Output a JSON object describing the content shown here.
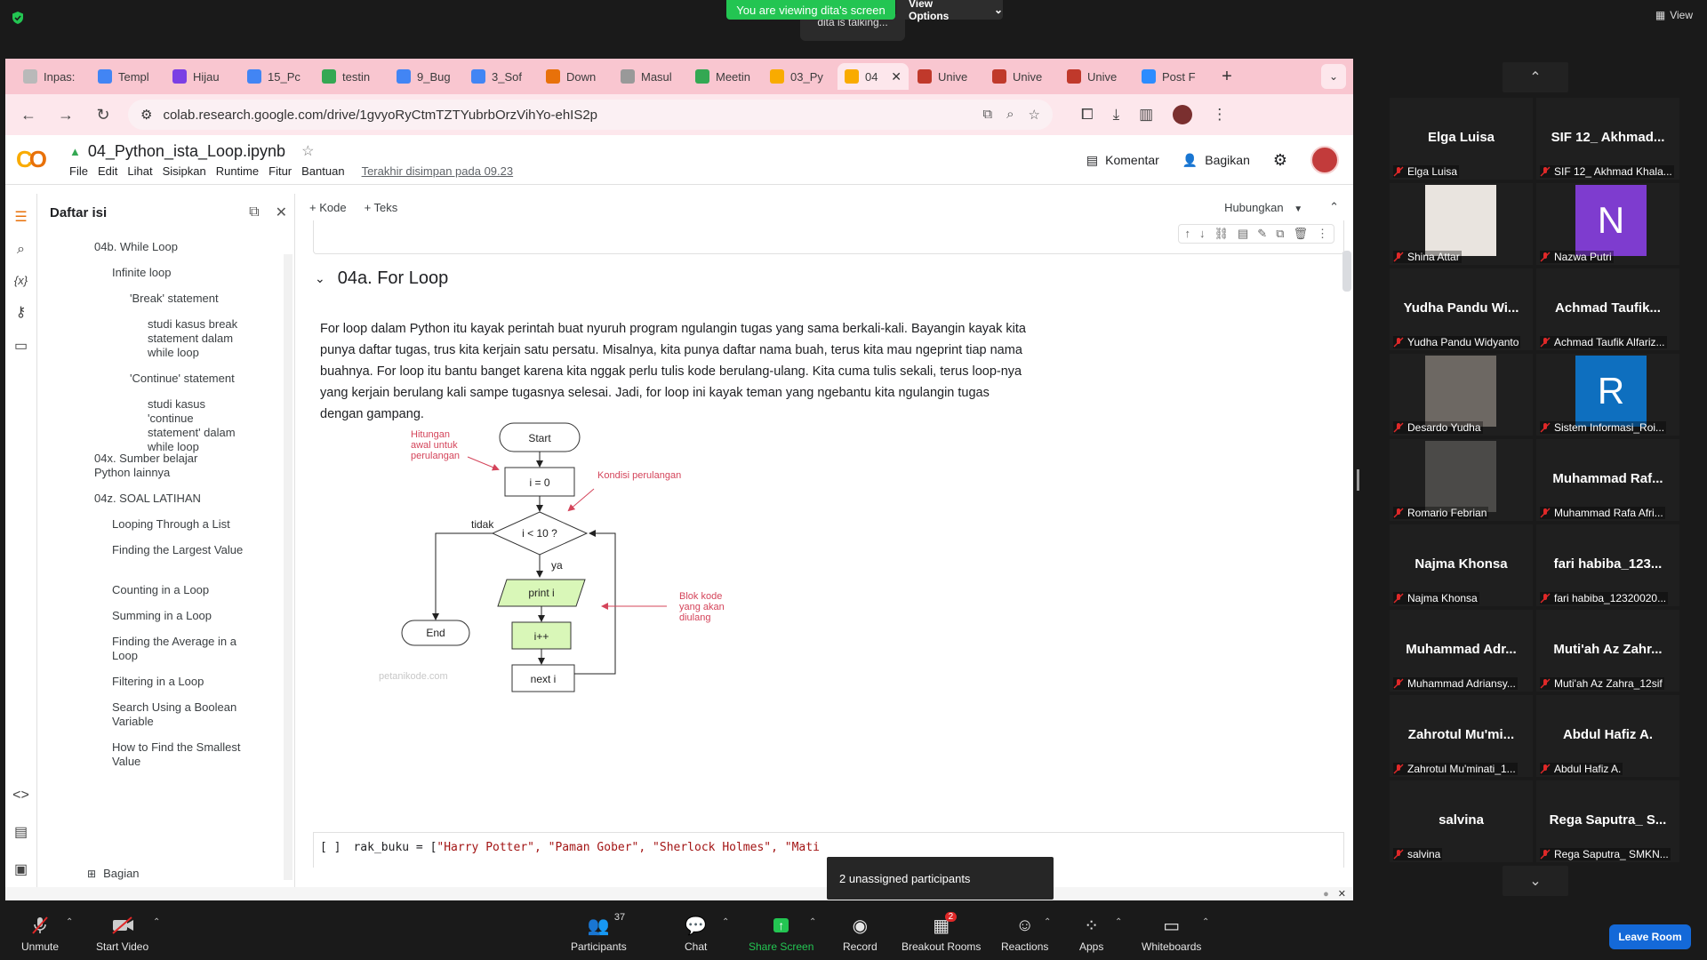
{
  "zoom": {
    "viewing_banner": "You are viewing dita's screen",
    "view_options": "View Options",
    "talking": "dita is talking...",
    "view_label": "View",
    "unassigned": "2 unassigned participants",
    "leave": "Leave Room",
    "controls": [
      {
        "label": "Unmute"
      },
      {
        "label": "Start Video"
      },
      {
        "label": "Participants",
        "count": "37"
      },
      {
        "label": "Chat"
      },
      {
        "label": "Share Screen"
      },
      {
        "label": "Record"
      },
      {
        "label": "Breakout Rooms",
        "badge": "2"
      },
      {
        "label": "Reactions"
      },
      {
        "label": "Apps"
      },
      {
        "label": "Whiteboards"
      }
    ]
  },
  "browser": {
    "tabs": [
      {
        "label": "Inpas:",
        "color": "#b9b9b9"
      },
      {
        "label": "Templ",
        "color": "#4285f4"
      },
      {
        "label": "Hijau",
        "color": "#7b3fe4"
      },
      {
        "label": "15_Pc",
        "color": "#4285f4"
      },
      {
        "label": "testin",
        "color": "#34a853"
      },
      {
        "label": "9_Bug",
        "color": "#4285f4"
      },
      {
        "label": "3_Sof",
        "color": "#4285f4"
      },
      {
        "label": "Down",
        "color": "#e8710a"
      },
      {
        "label": "Masul",
        "color": "#999999"
      },
      {
        "label": "Meetin",
        "color": "#34a853"
      },
      {
        "label": "03_Py",
        "color": "#f9ab00"
      },
      {
        "label": "04",
        "color": "#f9ab00"
      },
      {
        "label": "Unive",
        "color": "#c0392b"
      },
      {
        "label": "Unive",
        "color": "#c0392b"
      },
      {
        "label": "Unive",
        "color": "#c0392b"
      },
      {
        "label": "Post F",
        "color": "#2d8cff"
      }
    ],
    "url": "colab.research.google.com/drive/1gvyoRyCtmTZTYubrbOrzVihYo-ehIS2p"
  },
  "colab": {
    "title": "04_Python_ista_Loop.ipynb",
    "menu": [
      "File",
      "Edit",
      "Lihat",
      "Sisipkan",
      "Runtime",
      "Fitur",
      "Bantuan"
    ],
    "saved": "Terakhir disimpan pada 09.23",
    "comment": "Komentar",
    "share": "Bagikan",
    "add_code": "+ Kode",
    "add_text": "+ Teks",
    "connect": "Hubungkan",
    "toc_title": "Daftar isi",
    "toc": [
      {
        "label": "04b. While Loop",
        "level": 1
      },
      {
        "label": "Infinite loop",
        "level": 2
      },
      {
        "label": "'Break' statement",
        "level": 3
      },
      {
        "label": "studi kasus break statement dalam while loop",
        "level": 4
      },
      {
        "label": "'Continue' statement",
        "level": 3
      },
      {
        "label": "studi kasus 'continue statement' dalam while loop",
        "level": 4
      },
      {
        "label": "04x. Sumber belajar Python lainnya",
        "level": 1
      },
      {
        "label": "04z. SOAL LATIHAN",
        "level": 1
      },
      {
        "label": "Looping Through a List",
        "level": 2
      },
      {
        "label": "Finding the Largest Value",
        "level": 2
      },
      {
        "label": "Counting in a Loop",
        "level": 2
      },
      {
        "label": "Summing in a Loop",
        "level": 2
      },
      {
        "label": "Finding the Average in a Loop",
        "level": 2
      },
      {
        "label": "Filtering in a Loop",
        "level": 2
      },
      {
        "label": "Search Using a Boolean Variable",
        "level": 2
      },
      {
        "label": "How to Find the Smallest Value",
        "level": 2
      }
    ],
    "toc_section_btn": "Bagian",
    "section_heading": "04a. For Loop",
    "paragraph": "For loop dalam Python itu kayak perintah buat nyuruh program ngulangin tugas yang sama berkali-kali. Bayangin kayak kita punya daftar tugas, trus kita kerjain satu persatu. Misalnya, kita punya daftar nama buah, terus kita mau ngeprint tiap nama buahnya. For loop itu bantu banget karena kita nggak perlu tulis kode berulang-ulang. Kita cuma tulis sekali, terus loop-nya yang kerjain berulang kali sampe tugasnya selesai. Jadi, for loop ini kayak teman yang ngebantu kita ngulangin tugas dengan gampang.",
    "flowchart": {
      "start": "Start",
      "init": "i = 0",
      "cond": "i < 10 ?",
      "body": "print i",
      "inc": "i++",
      "next": "next i",
      "end": "End",
      "yes": "ya",
      "no": "tidak",
      "note_init": [
        "Hitungan",
        "awal untuk",
        "perulangan"
      ],
      "note_cond": "Kondisi perulangan",
      "note_body": [
        "Blok kode",
        "yang akan",
        "diulang"
      ],
      "watermark": "petanikode.com"
    },
    "code_bracket": "[ ]",
    "code_prefix": "rak_buku = [",
    "code_strings": [
      "\"Harry Potter\",",
      "\"Paman Gober\",",
      "\"Sherlock Holmes\",",
      "\"Mati"
    ]
  },
  "participants": [
    {
      "display": "Elga Luisa",
      "name": "Elga Luisa",
      "type": "name"
    },
    {
      "display": "SIF 12_ Akhmad...",
      "name": "SIF 12_ Akhmad Khala...",
      "type": "name"
    },
    {
      "display": "",
      "name": "Shina Attar",
      "type": "video",
      "color": "#e9e4df"
    },
    {
      "display": "N",
      "name": "Nazwa Putri",
      "type": "letter",
      "color": "#7e3ccf"
    },
    {
      "display": "Yudha Pandu Wi...",
      "name": "Yudha Pandu Widyanto",
      "type": "name"
    },
    {
      "display": "Achmad Taufik...",
      "name": "Achmad Taufik Alfariz...",
      "type": "name"
    },
    {
      "display": "",
      "name": "Desardo Yudha",
      "type": "video",
      "color": "#6d6863"
    },
    {
      "display": "R",
      "name": "Sistem Informasi_Roi...",
      "type": "letter",
      "color": "#0e6fbf"
    },
    {
      "display": "",
      "name": "Romario Febrian",
      "type": "video",
      "color": "#4b4a48"
    },
    {
      "display": "Muhammad Raf...",
      "name": "Muhammad Rafa Afri...",
      "type": "name"
    },
    {
      "display": "Najma Khonsa",
      "name": "Najma Khonsa",
      "type": "name"
    },
    {
      "display": "fari habiba_123...",
      "name": "fari habiba_12320020...",
      "type": "name"
    },
    {
      "display": "Muhammad Adr...",
      "name": "Muhammad Adriansy...",
      "type": "name"
    },
    {
      "display": "Muti'ah Az Zahr...",
      "name": "Muti'ah Az Zahra_12sif",
      "type": "name"
    },
    {
      "display": "Zahrotul Mu'mi...",
      "name": "Zahrotul Mu'minati_1...",
      "type": "name"
    },
    {
      "display": "Abdul Hafiz A.",
      "name": "Abdul Hafiz A.",
      "type": "name"
    },
    {
      "display": "salvina",
      "name": "salvina",
      "type": "name"
    },
    {
      "display": "Rega Saputra_ S...",
      "name": "Rega Saputra_ SMKN...",
      "type": "name"
    }
  ]
}
